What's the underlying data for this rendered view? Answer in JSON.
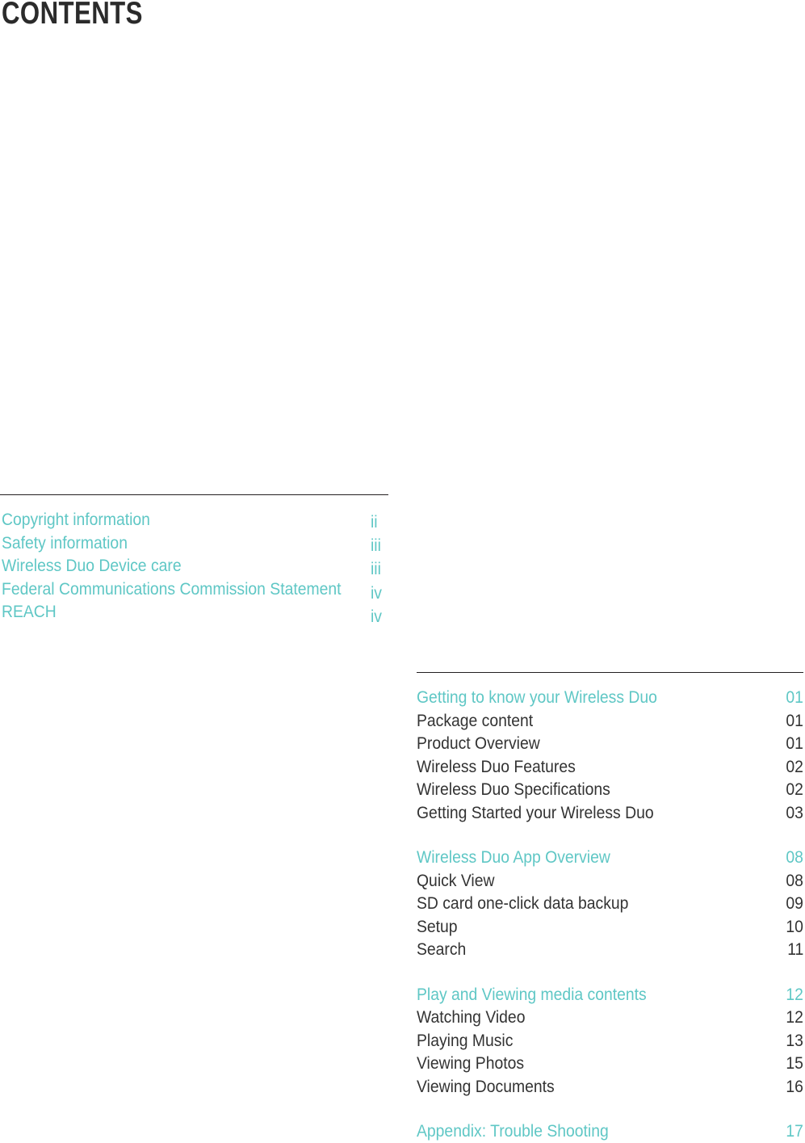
{
  "page": {
    "title": "CONTENTS",
    "colors": {
      "accent_teal": "#5FC7C5",
      "body_dark": "#333333",
      "rule": "#231F20",
      "background": "#FFFFFF"
    }
  },
  "front_matter": {
    "entries": [
      {
        "label": "Copyright information",
        "page": "ii"
      },
      {
        "label": "Safety information",
        "page": "iii"
      },
      {
        "label": "Wireless Duo Device care",
        "page": "iii"
      },
      {
        "label": "Federal Communications Commission Statement",
        "page": "iv"
      },
      {
        "label": "REACH",
        "page": "iv"
      }
    ]
  },
  "main_matter": {
    "groups": [
      {
        "entries": [
          {
            "label": "Getting to know your Wireless Duo",
            "page": "01",
            "heading": true
          },
          {
            "label": "Package content",
            "page": "01",
            "heading": false
          },
          {
            "label": "Product Overview",
            "page": "01",
            "heading": false
          },
          {
            "label": "Wireless Duo Features",
            "page": "02",
            "heading": false
          },
          {
            "label": "Wireless Duo Specifications",
            "page": "02",
            "heading": false
          },
          {
            "label": "Getting Started your Wireless Duo",
            "page": "03",
            "heading": false
          }
        ]
      },
      {
        "entries": [
          {
            "label": "Wireless Duo App Overview",
            "page": "08",
            "heading": true
          },
          {
            "label": "Quick View",
            "page": "08",
            "heading": false
          },
          {
            "label": "SD card one-click data backup",
            "page": "09",
            "heading": false
          },
          {
            "label": "Setup",
            "page": "10",
            "heading": false
          },
          {
            "label": "Search",
            "page": "11",
            "heading": false
          }
        ]
      },
      {
        "entries": [
          {
            "label": "Play and Viewing media contents",
            "page": "12",
            "heading": true
          },
          {
            "label": "Watching Video",
            "page": "12",
            "heading": false
          },
          {
            "label": "Playing Music",
            "page": "13",
            "heading": false
          },
          {
            "label": "Viewing Photos",
            "page": "15",
            "heading": false
          },
          {
            "label": "Viewing Documents",
            "page": "16",
            "heading": false
          }
        ]
      },
      {
        "entries": [
          {
            "label": "Appendix: Trouble Shooting",
            "page": "17",
            "heading": true
          }
        ]
      }
    ]
  }
}
